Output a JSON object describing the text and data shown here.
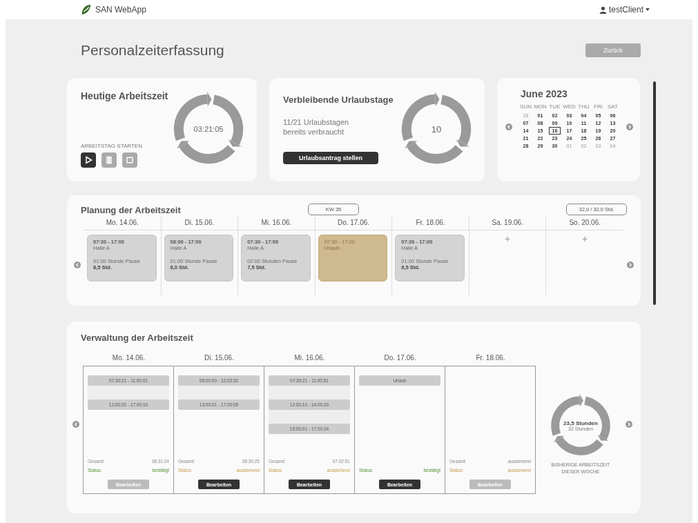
{
  "app": {
    "name": "SAN WebApp",
    "user": "testClient"
  },
  "page": {
    "title": "Personalzeiterfassung",
    "back_button": "Zurück"
  },
  "today": {
    "title": "Heutige Arbeitszeit",
    "time": "03:21:05",
    "start_label": "ARBEITSTAG STARTEN",
    "controls": [
      {
        "kind": "play",
        "selected": true
      },
      {
        "kind": "pause",
        "selected": false
      },
      {
        "kind": "stop",
        "selected": false
      }
    ]
  },
  "vacation": {
    "title": "Verbleibende Urlaubstage",
    "used_line1": "11/21 Urlaubstagen",
    "used_line2": "bereits verbraucht",
    "remaining": "10",
    "button": "Urlaubsantrag stellen"
  },
  "calendar": {
    "title": "June 2023",
    "weekdays": [
      "SUN",
      "MON",
      "TUE",
      "WED",
      "THU",
      "FRI",
      "SAT"
    ],
    "days": [
      {
        "label": "28",
        "in_month": false,
        "selected": false
      },
      {
        "label": "01",
        "in_month": true,
        "selected": false
      },
      {
        "label": "02",
        "in_month": true,
        "selected": false
      },
      {
        "label": "03",
        "in_month": true,
        "selected": false
      },
      {
        "label": "04",
        "in_month": true,
        "selected": false
      },
      {
        "label": "05",
        "in_month": true,
        "selected": false
      },
      {
        "label": "06",
        "in_month": true,
        "selected": false
      },
      {
        "label": "07",
        "in_month": true,
        "selected": false
      },
      {
        "label": "08",
        "in_month": true,
        "selected": false
      },
      {
        "label": "09",
        "in_month": true,
        "selected": false
      },
      {
        "label": "10",
        "in_month": true,
        "selected": false
      },
      {
        "label": "11",
        "in_month": true,
        "selected": false
      },
      {
        "label": "12",
        "in_month": true,
        "selected": false
      },
      {
        "label": "13",
        "in_month": true,
        "selected": false
      },
      {
        "label": "14",
        "in_month": true,
        "selected": false
      },
      {
        "label": "15",
        "in_month": true,
        "selected": false
      },
      {
        "label": "16",
        "in_month": true,
        "selected": true
      },
      {
        "label": "17",
        "in_month": true,
        "selected": false
      },
      {
        "label": "18",
        "in_month": true,
        "selected": false
      },
      {
        "label": "19",
        "in_month": true,
        "selected": false
      },
      {
        "label": "20",
        "in_month": true,
        "selected": false
      },
      {
        "label": "21",
        "in_month": true,
        "selected": false
      },
      {
        "label": "22",
        "in_month": true,
        "selected": false
      },
      {
        "label": "23",
        "in_month": true,
        "selected": false
      },
      {
        "label": "24",
        "in_month": true,
        "selected": false
      },
      {
        "label": "25",
        "in_month": true,
        "selected": false
      },
      {
        "label": "26",
        "in_month": true,
        "selected": false
      },
      {
        "label": "27",
        "in_month": true,
        "selected": false
      },
      {
        "label": "28",
        "in_month": true,
        "selected": false
      },
      {
        "label": "29",
        "in_month": true,
        "selected": false
      },
      {
        "label": "30",
        "in_month": true,
        "selected": false
      },
      {
        "label": "01",
        "in_month": false,
        "selected": false
      },
      {
        "label": "02",
        "in_month": false,
        "selected": false
      },
      {
        "label": "03",
        "in_month": false,
        "selected": false
      },
      {
        "label": "04",
        "in_month": false,
        "selected": false
      }
    ]
  },
  "planning": {
    "title": "Planung der Arbeitszeit",
    "week": "KW 35",
    "hours": "32,0 / 32,0 Std.",
    "days": [
      {
        "date": "Mo. 14.06.",
        "kind": "shift",
        "time": "07:30 - 17:00",
        "place": "Halle A",
        "pause": "01:00 Stunde Pause",
        "total": "8,5 Std."
      },
      {
        "date": "Di. 15.06.",
        "kind": "shift",
        "time": "08:00 - 17:00",
        "place": "Halle A",
        "pause": "01:00 Stunde Pause",
        "total": "8,0 Std."
      },
      {
        "date": "Mi. 16.06.",
        "kind": "shift",
        "time": "07:30 - 17:00",
        "place": "Halle A",
        "pause": "02:00 Stunden Pause",
        "total": "7,5 Std."
      },
      {
        "date": "Do. 17.06.",
        "kind": "vacation",
        "time": "07:30 - 17:00",
        "place": "Urlaub"
      },
      {
        "date": "Fr. 18.06.",
        "kind": "shift",
        "time": "07:30 - 17:00",
        "place": "Halle A",
        "pause": "01:00 Stunde Pause",
        "total": "8,5 Std."
      },
      {
        "date": "Sa. 19.06.",
        "kind": "empty",
        "add": "+"
      },
      {
        "date": "So. 20.06.",
        "kind": "empty",
        "add": "+"
      }
    ]
  },
  "management": {
    "title": "Verwaltung der Arbeitszeit",
    "days": [
      {
        "date": "Mo. 14.06.",
        "entries": [
          "07:30:21 - 11:00:01",
          "12:00:20 - 17:00:10"
        ],
        "total_label": "Gesamt:",
        "total": "08:31:24",
        "status_label": "Status:",
        "status": "bestätigt",
        "confirmed": true,
        "button": "Bearbeiten",
        "disabled": true
      },
      {
        "date": "Di. 15.06.",
        "entries": [
          "08:00:00 - 12:03:20",
          "13:00:01 - 17:00:05"
        ],
        "total_label": "Gesamt:",
        "total": "08:30:25",
        "status_label": "Status:",
        "status": "ausstehend",
        "confirmed": false,
        "button": "Bearbeiten",
        "disabled": false
      },
      {
        "date": "Mi. 16.06.",
        "entries": [
          "07:30:21 - 11:00:51",
          "12:00:10 - 14:00:20",
          "15:00:01 - 17:00:24"
        ],
        "total_label": "Gesamt:",
        "total": "07:02:51",
        "status_label": "Status:",
        "status": "ausstehend",
        "confirmed": false,
        "button": "Bearbeiten",
        "disabled": false
      },
      {
        "date": "Do. 17.06.",
        "entries": [
          "Urlaub"
        ],
        "status_label": "Status:",
        "status": "bestätigt",
        "confirmed": true,
        "button": "Bearbeiten",
        "disabled": false
      },
      {
        "date": "Fr. 18.06.",
        "total_label": "Gesamt:",
        "total": "ausstehend",
        "status_label": "Status:",
        "status": "ausstehend",
        "confirmed": false,
        "button": "Bearbeiten",
        "disabled": true
      }
    ],
    "summary": {
      "hours": "23,5 Stunden",
      "target": "32 Stunden",
      "caption_line1": "BISHERIGE ARBEITSZEIT",
      "caption_line2": "DIESER WOCHE"
    }
  }
}
